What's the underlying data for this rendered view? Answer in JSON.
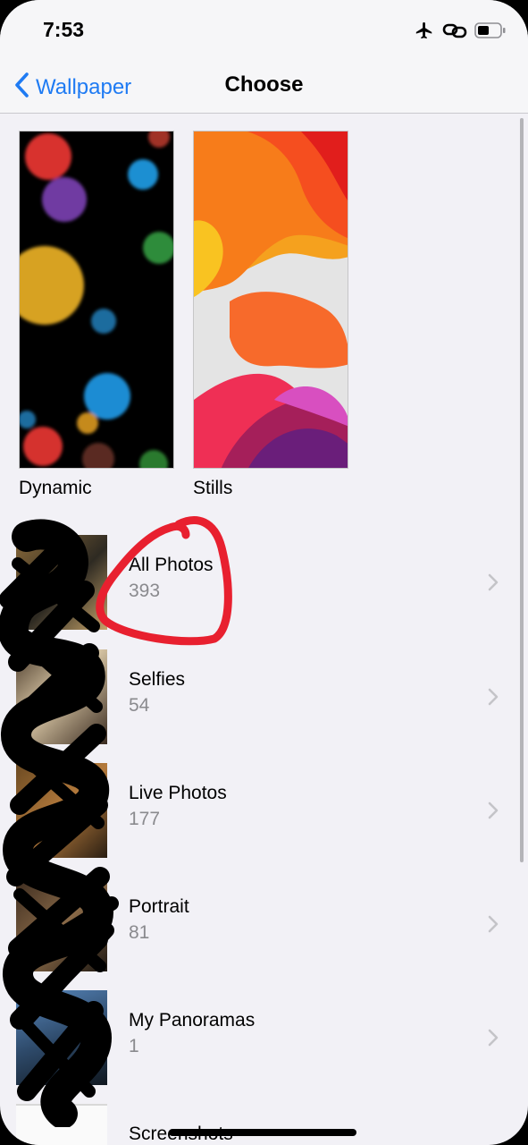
{
  "status_bar": {
    "time": "7:53",
    "icons": [
      "airplane-icon",
      "link-icon",
      "battery-icon"
    ]
  },
  "navbar": {
    "back_label": "Wallpaper",
    "title": "Choose"
  },
  "wallpapers": [
    {
      "label": "Dynamic"
    },
    {
      "label": "Stills"
    }
  ],
  "albums": [
    {
      "name": "All Photos",
      "count": "393"
    },
    {
      "name": "Selfies",
      "count": "54"
    },
    {
      "name": "Live Photos",
      "count": "177"
    },
    {
      "name": "Portrait",
      "count": "81"
    },
    {
      "name": "My Panoramas",
      "count": "1"
    },
    {
      "name": "Screenshots",
      "count": ""
    }
  ],
  "colors": {
    "accent": "#1f7bf3",
    "background": "#f2f1f6",
    "secondary_text": "#8a8a8e",
    "annotation_red": "#e8202f"
  }
}
